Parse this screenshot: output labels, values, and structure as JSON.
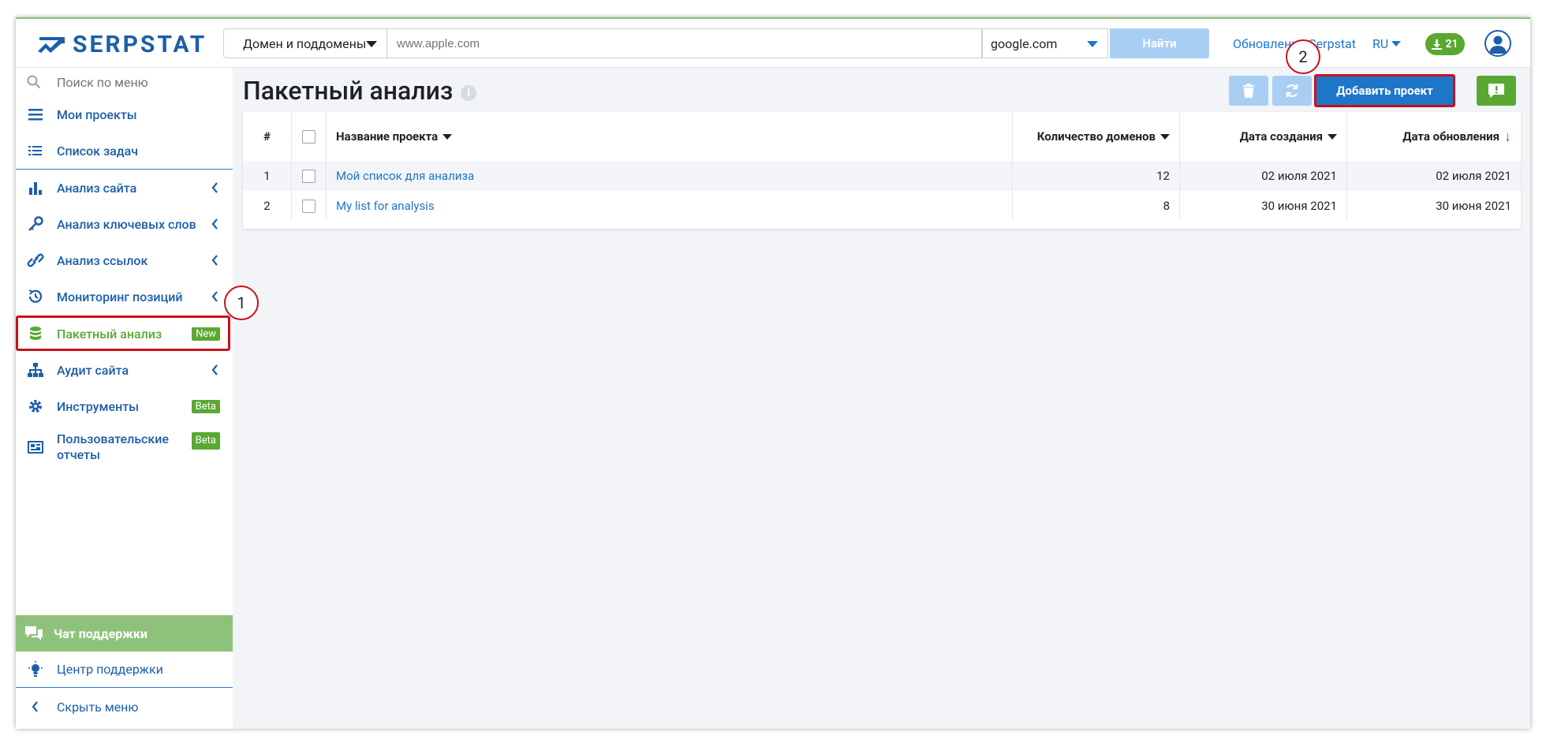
{
  "brand": {
    "name": "SERPSTAT"
  },
  "search": {
    "type_label": "Домен и поддомены",
    "placeholder": "www.apple.com",
    "engine": "google.com",
    "button": "Найти"
  },
  "header": {
    "updates_link": "Обновления Serpstat",
    "lang": "RU",
    "downloads_count": "21"
  },
  "sidebar": {
    "search_placeholder": "Поиск по меню",
    "items": [
      {
        "label": "Мои проекты"
      },
      {
        "label": "Список задач"
      },
      {
        "label": "Анализ сайта"
      },
      {
        "label": "Анализ ключевых слов"
      },
      {
        "label": "Анализ ссылок"
      },
      {
        "label": "Мониторинг позиций"
      },
      {
        "label": "Пакетный анализ",
        "badge": "New"
      },
      {
        "label": "Аудит сайта"
      },
      {
        "label": "Инструменты",
        "badge": "Beta"
      },
      {
        "label": "Пользовательские отчеты",
        "badge": "Beta"
      }
    ],
    "support_chat": "Чат поддержки",
    "support_center": "Центр поддержки",
    "hide_menu": "Скрыть меню"
  },
  "callouts": {
    "one": "1",
    "two": "2"
  },
  "page": {
    "title": "Пакетный анализ",
    "add_button": "Добавить проект"
  },
  "table": {
    "headers": {
      "num": "#",
      "name": "Название проекта",
      "domains": "Количество доменов",
      "created": "Дата создания",
      "updated": "Дата обновления"
    },
    "rows": [
      {
        "num": "1",
        "name": "Мой список для анализа",
        "domains": "12",
        "created": "02 июля 2021",
        "updated": "02 июля 2021"
      },
      {
        "num": "2",
        "name": "My list for analysis",
        "domains": "8",
        "created": "30 июня 2021",
        "updated": "30 июня 2021"
      }
    ]
  },
  "colors": {
    "brand_blue": "#1c5fa8",
    "link_blue": "#1e76c9",
    "accent_green": "#5aa832",
    "highlight_red": "#c8101e",
    "disabled_blue": "#a9cef4"
  }
}
